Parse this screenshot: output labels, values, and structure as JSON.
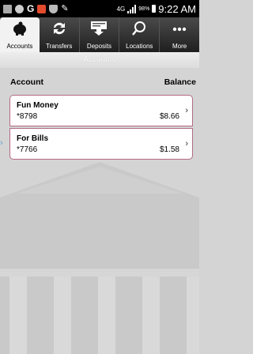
{
  "statusbar": {
    "network": "4G",
    "battery": "98%",
    "time": "9:22 AM"
  },
  "tabs": [
    {
      "label": "Accounts",
      "icon": "piggy-bank-icon"
    },
    {
      "label": "Transfers",
      "icon": "transfer-arrows-icon"
    },
    {
      "label": "Deposits",
      "icon": "deposit-icon"
    },
    {
      "label": "Locations",
      "icon": "search-icon"
    },
    {
      "label": "More",
      "icon": "more-dots-icon"
    }
  ],
  "subheader": {
    "title": "Accounts"
  },
  "columns": {
    "account": "Account",
    "balance": "Balance"
  },
  "accounts": [
    {
      "name": "Fun Money",
      "number": "*8798",
      "balance": "$8.66"
    },
    {
      "name": "For Bills",
      "number": "*7766",
      "balance": "$1.58"
    }
  ],
  "colors": {
    "accent": "#b36a86",
    "tabbar": "#2e2e2e",
    "background": "#d4d4d4"
  }
}
